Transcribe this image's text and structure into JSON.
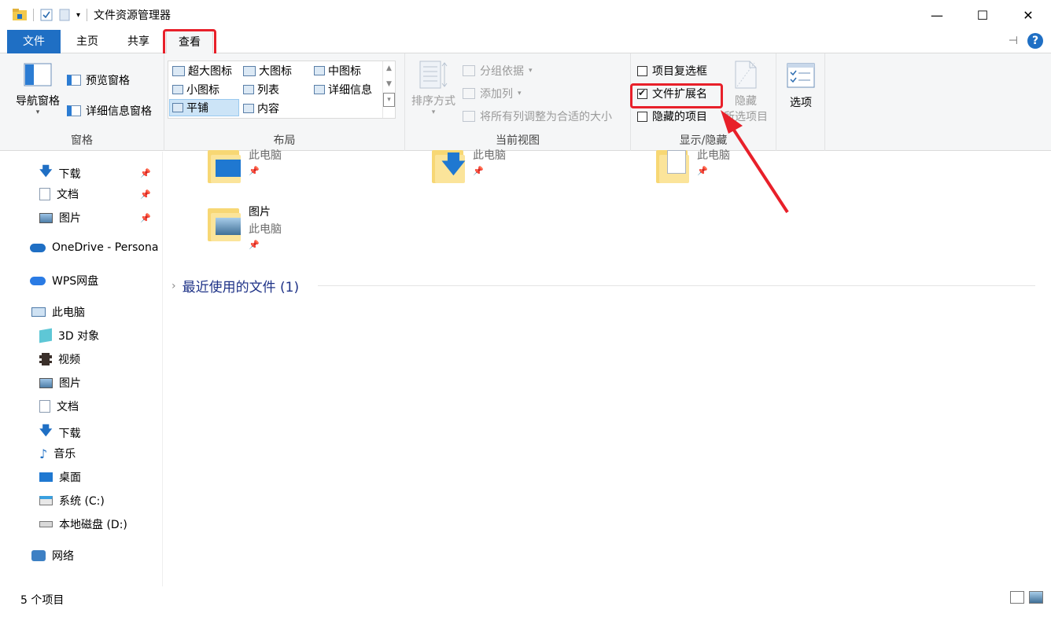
{
  "window": {
    "title": "文件资源管理器",
    "controls": {
      "minimize": "—",
      "maximize": "☐",
      "close": "✕"
    }
  },
  "tabs": [
    {
      "label": "文件"
    },
    {
      "label": "主页"
    },
    {
      "label": "共享"
    },
    {
      "label": "查看"
    }
  ],
  "ribbon": {
    "pane": {
      "nav_pane": "导航窗格",
      "preview_pane": "预览窗格",
      "details_pane": "详细信息窗格",
      "label": "窗格"
    },
    "layout": {
      "extra_large": "超大图标",
      "large": "大图标",
      "medium": "中图标",
      "small": "小图标",
      "list": "列表",
      "details": "详细信息",
      "tiles": "平铺",
      "content": "内容",
      "label": "布局"
    },
    "current_view": {
      "sort_by": "排序方式",
      "group_by": "分组依据",
      "add_columns": "添加列",
      "size_all": "将所有列调整为合适的大小",
      "label": "当前视图"
    },
    "show_hide": {
      "item_checkboxes": "项目复选框",
      "file_extensions": "文件扩展名",
      "hidden_items": "隐藏的项目",
      "hide_selected_1": "隐藏",
      "hide_selected_2": "所选项目",
      "label": "显示/隐藏",
      "item_checkboxes_checked": false,
      "file_extensions_checked": true,
      "hidden_items_checked": false
    },
    "options": {
      "label": "选项"
    }
  },
  "nav": [
    {
      "label": "下载",
      "icon": "download-arrow-icon",
      "pinned": true
    },
    {
      "label": "文档",
      "icon": "document-icon",
      "pinned": true
    },
    {
      "label": "图片",
      "icon": "picture-icon",
      "pinned": true
    },
    {
      "label": "OneDrive - Persona",
      "icon": "onedrive-cloud-icon"
    },
    {
      "label": "WPS网盘",
      "icon": "wps-cloud-icon"
    },
    {
      "label": "此电脑",
      "icon": "computer-icon"
    },
    {
      "label": "3D 对象",
      "icon": "cube-3d-icon"
    },
    {
      "label": "视频",
      "icon": "film-icon"
    },
    {
      "label": "图片",
      "icon": "picture-icon"
    },
    {
      "label": "文档",
      "icon": "document-icon"
    },
    {
      "label": "下载",
      "icon": "download-arrow-icon"
    },
    {
      "label": "音乐",
      "icon": "music-note-icon"
    },
    {
      "label": "桌面",
      "icon": "desktop-icon"
    },
    {
      "label": "系统 (C:)",
      "icon": "system-drive-icon"
    },
    {
      "label": "本地磁盘 (D:)",
      "icon": "disk-drive-icon"
    },
    {
      "label": "网络",
      "icon": "network-icon"
    }
  ],
  "content": {
    "tiles": [
      {
        "name": "",
        "sub": "此电脑",
        "pin": "📌"
      },
      {
        "name": "",
        "sub": "此电脑",
        "pin": "📌"
      },
      {
        "name": "",
        "sub": "此电脑",
        "pin": "📌"
      },
      {
        "name": "图片",
        "sub": "此电脑",
        "pin": "📌"
      }
    ],
    "recent_section": "最近使用的文件 (1)"
  },
  "status": {
    "count": "5 个项目"
  },
  "colors": {
    "accent": "#1f6fc4",
    "highlight_red": "#e8202a",
    "section_text": "#1e3287"
  }
}
